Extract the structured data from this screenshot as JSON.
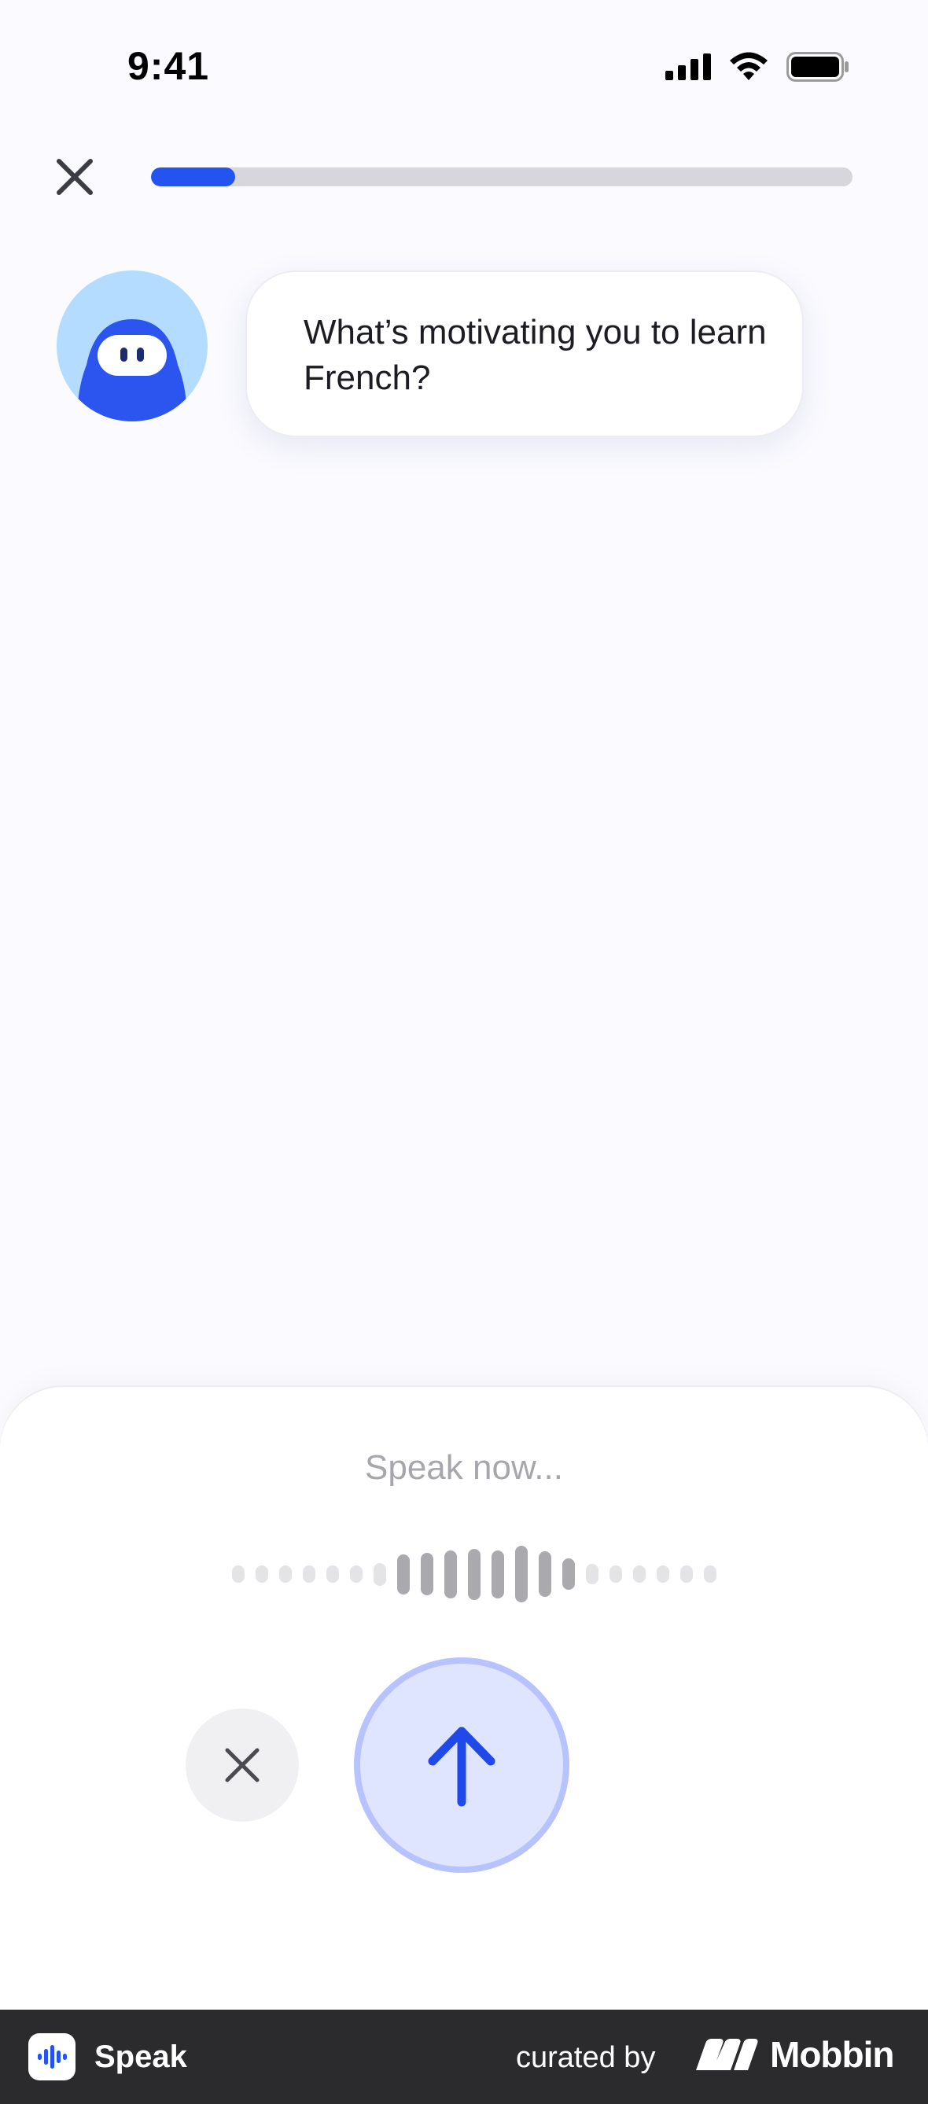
{
  "status_bar": {
    "time": "9:41",
    "icons": [
      "cellular-signal-icon",
      "wifi-icon",
      "battery-icon"
    ]
  },
  "header": {
    "close_icon": "close-icon",
    "progress_fraction": 0.12,
    "progress_color": "#2454f0"
  },
  "conversation": {
    "avatar_icon": "robot-mascot-icon",
    "message": "What’s motivating you to learn French?"
  },
  "recorder": {
    "prompt": "Speak now...",
    "waveform_levels": [
      0.3,
      0.3,
      0.3,
      0.3,
      0.3,
      0.3,
      0.4,
      0.7,
      0.75,
      0.85,
      0.9,
      0.85,
      1.0,
      0.8,
      0.55,
      0.35,
      0.3,
      0.3,
      0.3,
      0.3,
      0.3
    ],
    "cancel_icon": "close-icon",
    "send_icon": "arrow-up-icon",
    "accent_color": "#2454f0"
  },
  "footer": {
    "app_name": "Speak",
    "curated_by": "curated by",
    "brand": "Mobbin"
  }
}
